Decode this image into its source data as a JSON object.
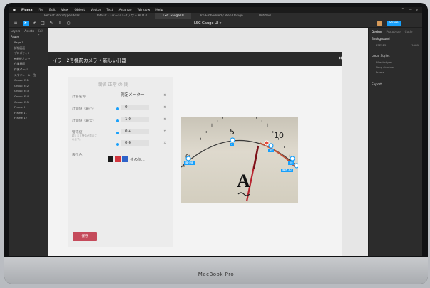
{
  "menubar": {
    "app": "Figma",
    "items": [
      "File",
      "Edit",
      "View",
      "Object",
      "Vector",
      "Text",
      "Arrange",
      "Window",
      "Help"
    ]
  },
  "tabs": [
    {
      "label": "Recent Prototype Ideas"
    },
    {
      "label": "Default - 2ページ レイアウト BLD 2"
    },
    {
      "label": "LSC Gauge UI",
      "active": true
    },
    {
      "label": "Pro Embedded / Web Design"
    },
    {
      "label": "Untitled"
    }
  ],
  "toolbar": {
    "filename": "LSC Gauge UI ▾",
    "share_label": "Share"
  },
  "left_panel": {
    "tabs": [
      "Layers",
      "Assets",
      "Edit ▾"
    ],
    "pages_header": "Pages",
    "layers": [
      "Page 1",
      "詳細画面",
      "プロパティ1",
      "▾ 新規カメラ",
      "作業画面",
      "作業ページ",
      "スケジュール一覧",
      "Group 351",
      "Group 352",
      "Group 353",
      "Group 354",
      "Group 355",
      "Frame 2",
      "Frame 11",
      "Frame 12"
    ]
  },
  "modal": {
    "title": "イラー2号機前カメラ • 新しい計器",
    "close": "×",
    "form_title": "閾値 正常 の 閾",
    "fields": [
      {
        "label": "計器名称",
        "value": "測定メーター"
      },
      {
        "label": "計測値（最小）",
        "value": "0"
      },
      {
        "label": "計測値（最大）",
        "value": "1.0"
      },
      {
        "label": "警戒値",
        "sub": "越えると警告が表示されます。",
        "value": "0.4"
      },
      {
        "label": "",
        "value": "0.6"
      },
      {
        "label": "表示色",
        "value": "その他..."
      }
    ],
    "colors": [
      "#1a1a1a",
      "#d3363f",
      "#2f63c9"
    ],
    "save_label": "保存"
  },
  "gauge": {
    "scale_labels": [
      "0",
      "5",
      "10"
    ],
    "markers": [
      {
        "label": "最小値"
      },
      {
        "label": "4"
      },
      {
        "label": "10"
      },
      {
        "label": "20"
      },
      {
        "label": "最大 30"
      }
    ],
    "face_letter": "A"
  },
  "right_panel": {
    "tabs": [
      "Design",
      "Prototype",
      "Code"
    ],
    "background_header": "Background",
    "background_value": "E5E5E5",
    "background_opacity": "100%",
    "local_styles_header": "Local Styles",
    "styles_sub": "Effect styles",
    "styles": [
      "Drop shadow",
      "Frame"
    ],
    "export_header": "Export"
  },
  "chin": {
    "label": "MacBook Pro"
  },
  "dock_colors": [
    "#3b8cf0",
    "#e8e8e8",
    "#3a9e4d",
    "#f05a28",
    "#9b59b6",
    "#2ecc71",
    "#e74c3c",
    "#f1c40f",
    "#1abc9c",
    "#34495e",
    "#e67e22",
    "#95a5a6",
    "#3498db",
    "#e84393",
    "#00cec9",
    "#fdcb6e",
    "#6c5ce7",
    "#d63031",
    "#636e72",
    "#0984e3",
    "#b2bec3",
    "#ffffff"
  ]
}
